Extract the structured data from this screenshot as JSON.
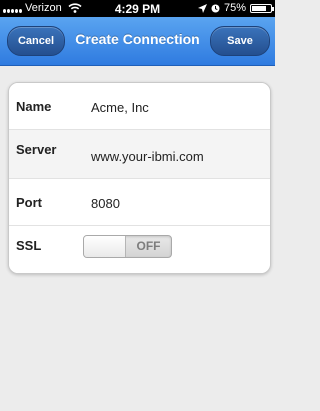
{
  "status_bar": {
    "carrier": "Verizon",
    "time": "4:29 PM",
    "battery": "75%",
    "battery_level": 0.75,
    "icons": [
      "signal-dots-icon",
      "wifi-icon",
      "location-arrow-icon",
      "alarm-clock-icon",
      "battery-icon"
    ]
  },
  "header": {
    "title": "Create Connection",
    "cancel_label": "Cancel",
    "save_label": "Save",
    "bar_color": "#3d8be8"
  },
  "form": {
    "name": {
      "label": "Name",
      "value": "Acme, Inc"
    },
    "server": {
      "label": "Server",
      "value": "www.your-ibmi.com"
    },
    "port": {
      "label": "Port",
      "value": "8080"
    },
    "ssl": {
      "label": "SSL",
      "toggle_text": "OFF",
      "enabled": false
    }
  }
}
